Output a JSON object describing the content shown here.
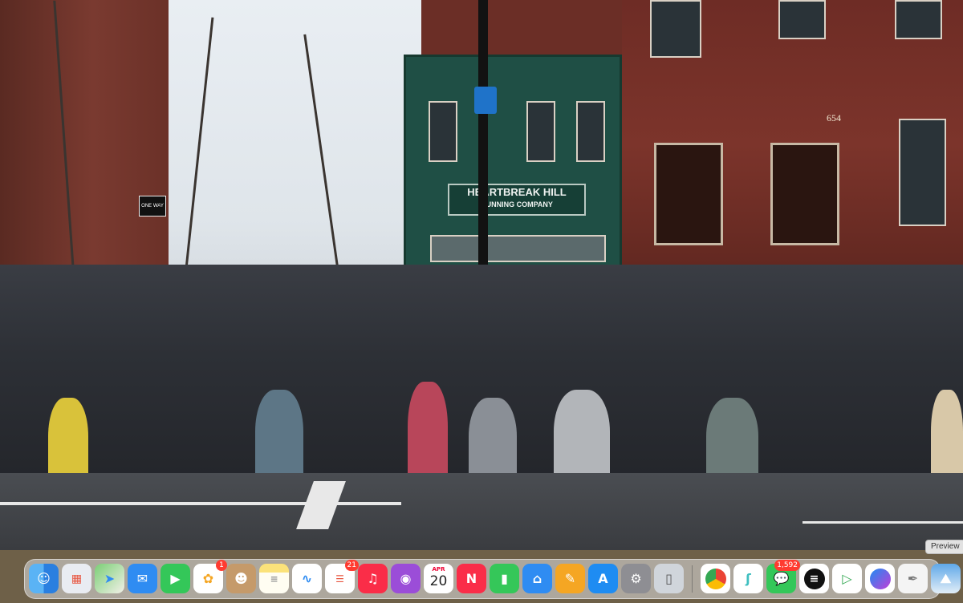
{
  "photo": {
    "storefront_sign_line1": "HEARTBREAK HILL",
    "storefront_sign_line2": "RUNNING COMPANY",
    "street_sign": "ONE WAY",
    "address_number": "654"
  },
  "dock": {
    "hovered_tooltip": "Preview",
    "items": [
      {
        "name": "Finder",
        "icon": "finder-icon",
        "color": "#3a8ef0"
      },
      {
        "name": "Launchpad",
        "icon": "launchpad-icon",
        "color": "#e2e6ee"
      },
      {
        "name": "Maps",
        "icon": "maps-icon",
        "color": "#5cb85c"
      },
      {
        "name": "Mail",
        "icon": "mail-icon",
        "color": "#2f8cf2"
      },
      {
        "name": "FaceTime",
        "icon": "facetime-icon",
        "color": "#34c759"
      },
      {
        "name": "Photos",
        "icon": "photos-icon",
        "color": "#ffffff",
        "badge": "1"
      },
      {
        "name": "Contacts",
        "icon": "contacts-icon",
        "color": "#b88a5a"
      },
      {
        "name": "Notes",
        "icon": "notes-icon",
        "color": "#fbe27a"
      },
      {
        "name": "Freeform",
        "icon": "freeform-icon",
        "color": "#ffffff"
      },
      {
        "name": "Reminders",
        "icon": "reminders-icon",
        "color": "#ffffff",
        "badge": "21"
      },
      {
        "name": "Music",
        "icon": "music-icon",
        "color": "#fa2d48"
      },
      {
        "name": "Podcasts",
        "icon": "podcasts-icon",
        "color": "#9b4dd8"
      },
      {
        "name": "Calendar",
        "icon": "calendar-icon",
        "color": "#ffffff",
        "month": "APR",
        "day": "20"
      },
      {
        "name": "News",
        "icon": "news-icon",
        "color": "#fa2d48"
      },
      {
        "name": "Numbers",
        "icon": "numbers-icon",
        "color": "#35c759"
      },
      {
        "name": "Keynote",
        "icon": "keynote-icon",
        "color": "#2f8cf2"
      },
      {
        "name": "Pages",
        "icon": "pages-icon",
        "color": "#f5a623"
      },
      {
        "name": "App Store",
        "icon": "app-store-icon",
        "color": "#1e8cf2"
      },
      {
        "name": "System Settings",
        "icon": "gear-icon",
        "color": "#8e8e93"
      },
      {
        "name": "iPhone Mirroring",
        "icon": "iphone-mirroring-icon",
        "color": "#cfd4da"
      },
      {
        "name": "Chrome",
        "icon": "chrome-icon",
        "color": "#ffffff"
      },
      {
        "name": "Linear",
        "icon": "linear-icon",
        "color": "#3fbfc0"
      },
      {
        "name": "Messages",
        "icon": "messages-icon",
        "color": "#34c759",
        "badge": "1,592"
      },
      {
        "name": "ChatGPT",
        "icon": "chatgpt-icon",
        "color": "#ffffff"
      },
      {
        "name": "Play",
        "icon": "play-icon",
        "color": "#ffffff"
      },
      {
        "name": "Messenger",
        "icon": "messenger-icon",
        "color": "#ffffff"
      },
      {
        "name": "TextEdit",
        "icon": "textedit-icon",
        "color": "#f4f4f4"
      },
      {
        "name": "Preview",
        "icon": "preview-icon",
        "color": "#5fa8e8"
      }
    ]
  }
}
